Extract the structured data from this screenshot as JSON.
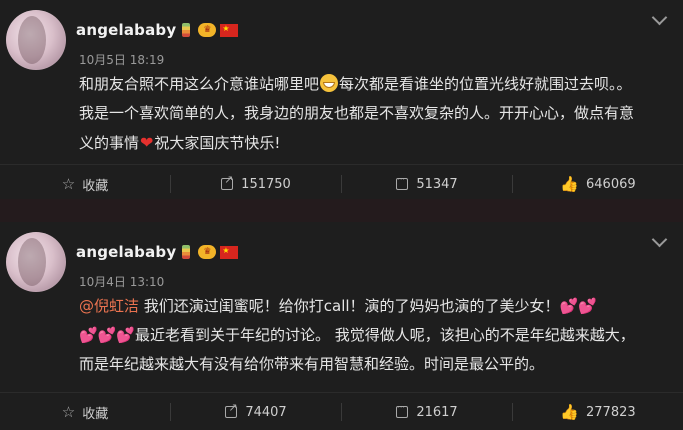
{
  "posts": [
    {
      "username": "angelababy",
      "time": "10月5日 18:19",
      "text_parts": [
        "和朋友合照不用这么介意谁站哪里吧",
        "每次都是看谁坐的位置光线好就围过去呗。。我是一个喜欢简单的人，我身边的朋友也都是不喜欢复杂的人。开开心心，做点有意义的事情",
        "祝大家国庆节快乐!"
      ],
      "actions": {
        "favorite": "收藏",
        "share": "151750",
        "comment": "51347",
        "like": "646069"
      }
    },
    {
      "username": "angelababy",
      "time": "10月4日 13:10",
      "mention": "@倪虹洁",
      "text_parts": [
        " 我们还演过闺蜜呢！给你打call！演的了妈妈也演的了美少女！",
        "最近老看到关于年纪的讨论。 我觉得做人呢，该担心的不是年纪越来越大，而是年纪越来越大有没有给你带来有用智慧和经验。时间是最公平的。"
      ],
      "actions": {
        "favorite": "收藏",
        "share": "74407",
        "comment": "21617",
        "like": "277823"
      }
    }
  ],
  "icons": {
    "menu": "chevron-down-icon",
    "favorite": "star-icon",
    "share": "share-icon",
    "comment": "comment-icon",
    "like": "thumbs-up-icon"
  },
  "colors": {
    "mention": "#eb7350",
    "background": "#1e1e1e"
  }
}
